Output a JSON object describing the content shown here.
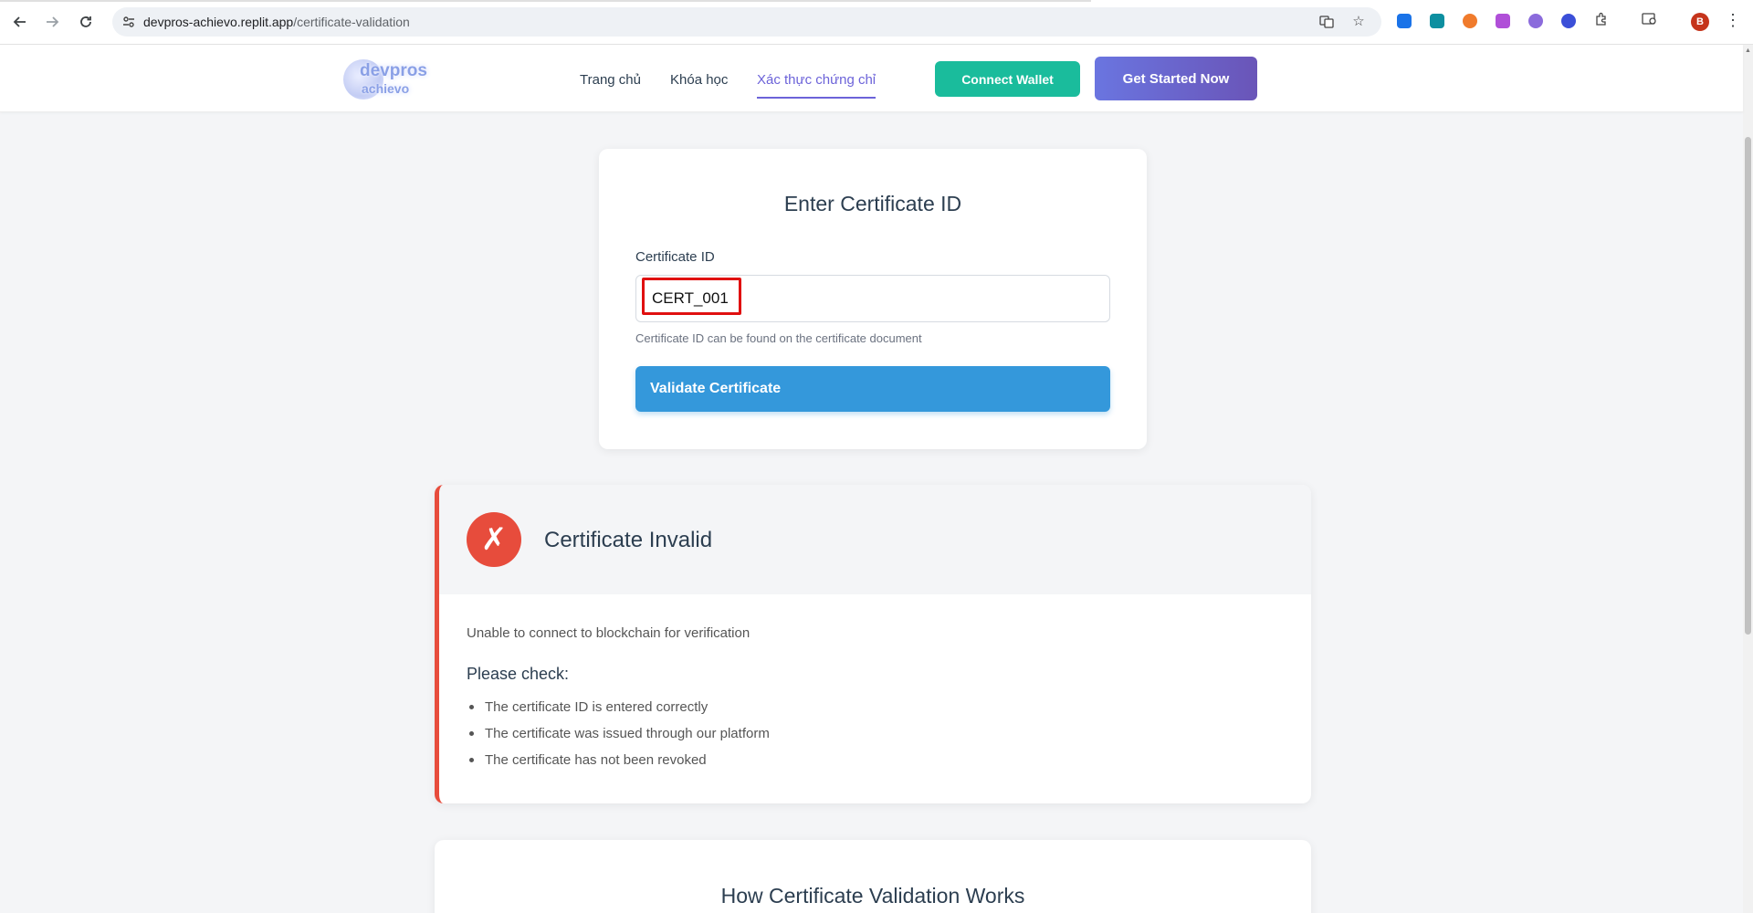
{
  "browser": {
    "url_host": "devpros-achievo.replit.app",
    "url_path": "/certificate-validation",
    "profile_initial": "B",
    "extension_colors": [
      "#1a73e8",
      "#0d8fa0",
      "#f07b2c",
      "#b04fd8",
      "#8b6bdc",
      "#3b4fd8"
    ]
  },
  "header": {
    "logo_line1": "devpros",
    "logo_line2": "achievo",
    "nav": [
      {
        "label": "Trang chủ",
        "active": false
      },
      {
        "label": "Khóa học",
        "active": false
      },
      {
        "label": "Xác thực chứng chỉ",
        "active": true
      }
    ],
    "connect_wallet_label": "Connect Wallet",
    "get_started_label": "Get Started Now"
  },
  "form": {
    "title": "Enter Certificate ID",
    "label": "Certificate ID",
    "value": "CERT_001",
    "help": "Certificate ID can be found on the certificate document",
    "submit_label": "Validate Certificate"
  },
  "result": {
    "icon": "✗",
    "title": "Certificate Invalid",
    "message": "Unable to connect to blockchain for verification",
    "check_title": "Please check:",
    "checks": [
      "The certificate ID is entered correctly",
      "The certificate was issued through our platform",
      "The certificate has not been revoked"
    ],
    "accent_color": "#e74c3c"
  },
  "how": {
    "title": "How Certificate Validation Works"
  }
}
